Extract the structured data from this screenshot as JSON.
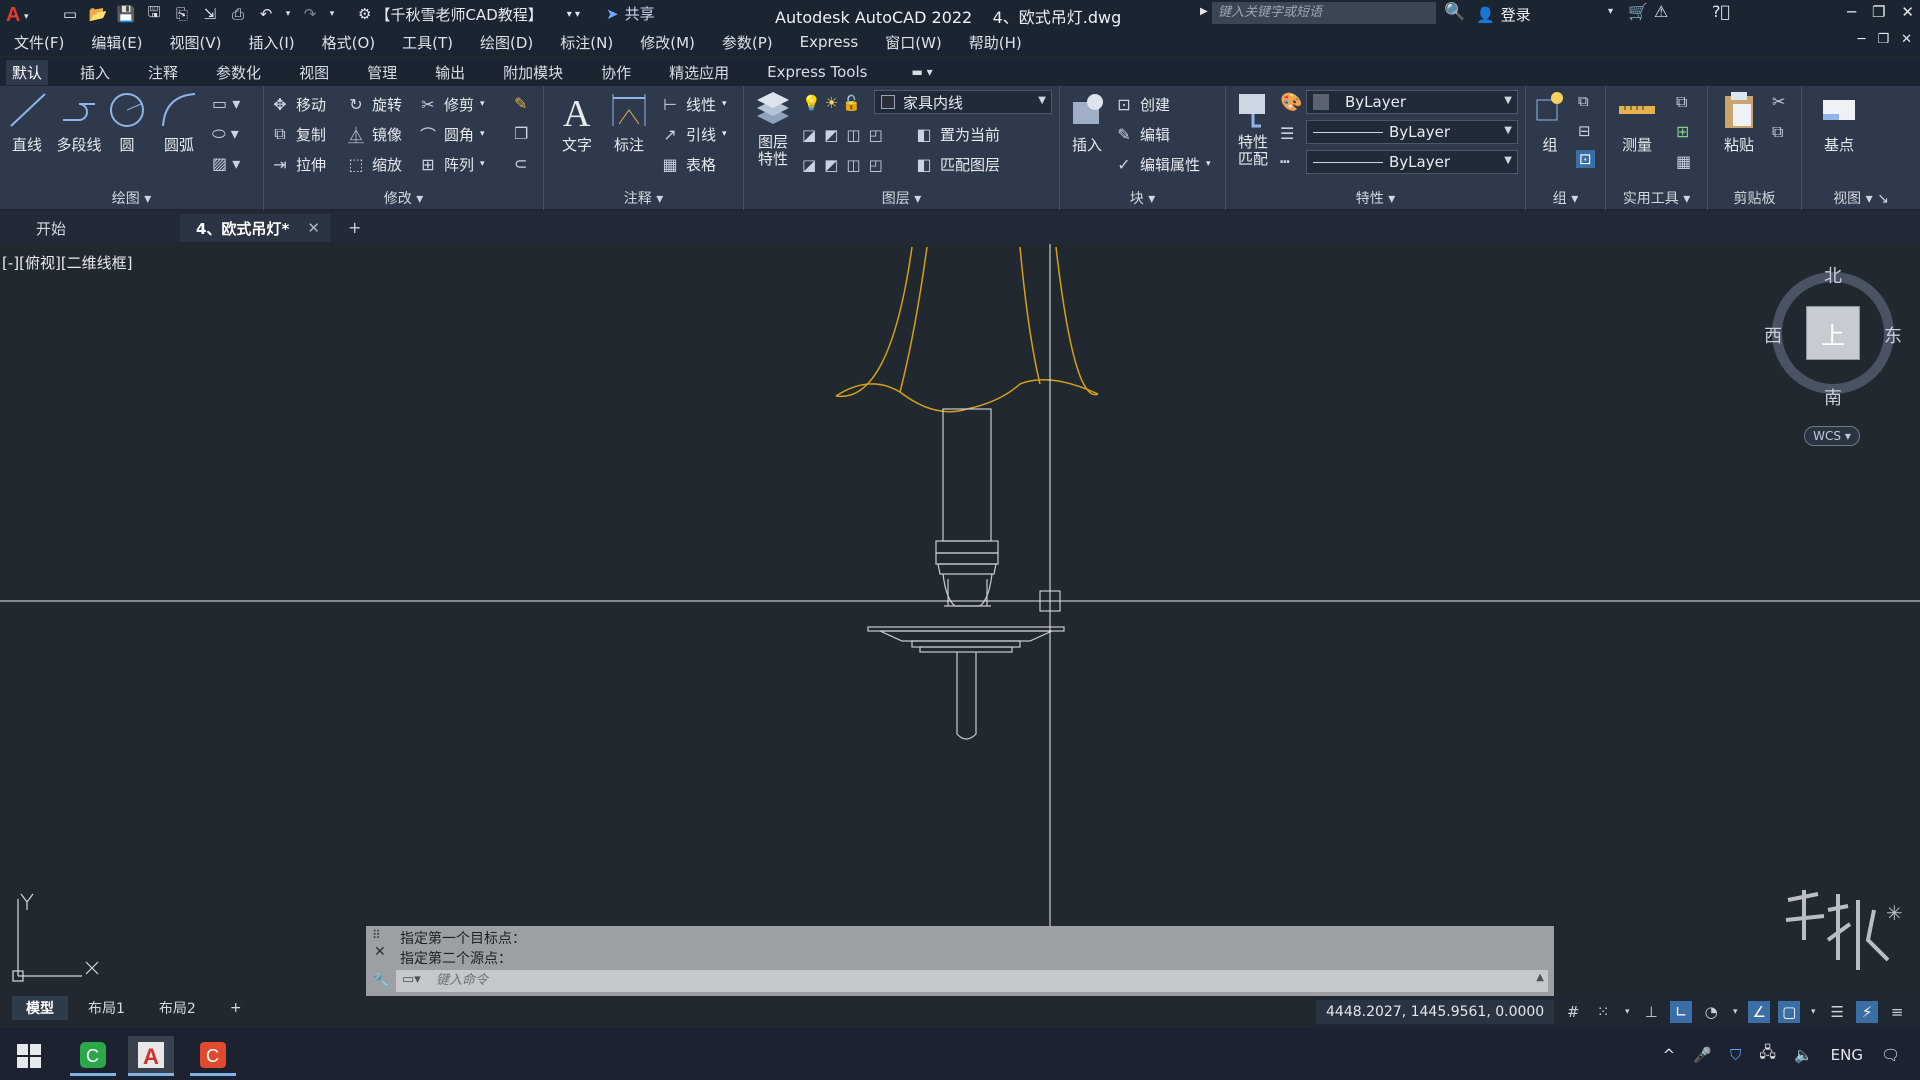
{
  "titlebar": {
    "workspace": "【千秋雪老师CAD教程】",
    "share": "共享",
    "app_title": "Autodesk AutoCAD 2022",
    "file_title": "4、欧式吊灯.dwg",
    "search_placeholder": "键入关键字或短语",
    "login": "登录"
  },
  "menu": [
    "文件(F)",
    "编辑(E)",
    "视图(V)",
    "插入(I)",
    "格式(O)",
    "工具(T)",
    "绘图(D)",
    "标注(N)",
    "修改(M)",
    "参数(P)",
    "Express",
    "窗口(W)",
    "帮助(H)"
  ],
  "ribbon_tabs": [
    "默认",
    "插入",
    "注释",
    "参数化",
    "视图",
    "管理",
    "输出",
    "附加模块",
    "协作",
    "精选应用",
    "Express Tools"
  ],
  "ribbon": {
    "draw": {
      "title": "绘图",
      "line": "直线",
      "polyline": "多段线",
      "circle": "圆",
      "arc": "圆弧"
    },
    "modify": {
      "title": "修改",
      "move": "移动",
      "rotate": "旋转",
      "trim": "修剪",
      "copy": "复制",
      "mirror": "镜像",
      "fillet": "圆角",
      "stretch": "拉伸",
      "scale": "缩放",
      "array": "阵列"
    },
    "annotation": {
      "title": "注释",
      "text": "文字",
      "dimension": "标注",
      "linear": "线性",
      "leader": "引线",
      "table": "表格"
    },
    "layers": {
      "title": "图层",
      "properties": "图层\n特性",
      "props_l1": "图层",
      "props_l2": "特性",
      "current_layer": "家具内线",
      "set_current": "置为当前",
      "match_layer": "匹配图层"
    },
    "block": {
      "title": "块",
      "insert": "插入",
      "create": "创建",
      "edit": "编辑",
      "edit_attr": "编辑属性"
    },
    "properties": {
      "title": "特性",
      "match_l1": "特性",
      "match_l2": "匹配",
      "color": "ByLayer",
      "lineweight": "ByLayer",
      "linetype": "ByLayer"
    },
    "groups": {
      "title": "组",
      "group": "组"
    },
    "utilities": {
      "title": "实用工具",
      "measure": "测量"
    },
    "clipboard": {
      "title": "剪贴板",
      "paste": "粘贴"
    },
    "view": {
      "title": "视图",
      "base": "基点"
    }
  },
  "file_tabs": {
    "start": "开始",
    "active": "4、欧式吊灯*"
  },
  "viewport": {
    "label": "[-][俯视][二维线框]",
    "compass": {
      "north": "北",
      "south": "南",
      "east": "东",
      "west": "西",
      "top": "上"
    },
    "wcs": "WCS"
  },
  "command": {
    "history": [
      "指定第一个目标点：",
      "指定第二个源点："
    ],
    "placeholder": "键入命令"
  },
  "layout_tabs": [
    "模型",
    "布局1",
    "布局2"
  ],
  "status": {
    "coords": "4448.2027, 1445.9561, 0.0000",
    "lang": "ENG"
  },
  "colors": {
    "accent": "#3a6ea5",
    "drawing_yellow": "#d4a017",
    "drawing_white": "#c8ccd2",
    "background": "#212830"
  }
}
